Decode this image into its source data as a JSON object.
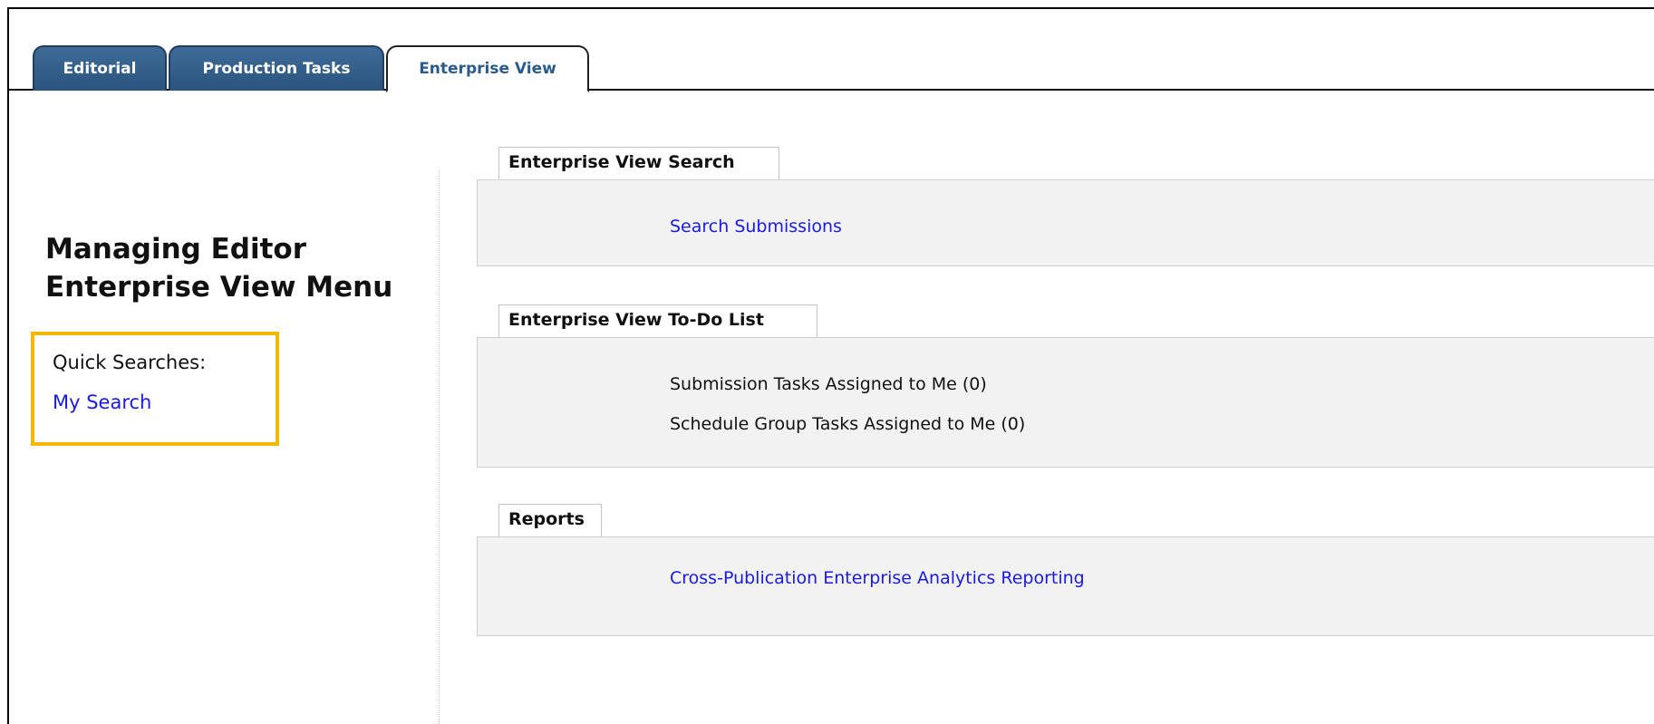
{
  "tabs": [
    {
      "label": "Editorial",
      "active": false
    },
    {
      "label": "Production Tasks",
      "active": false
    },
    {
      "label": "Enterprise View",
      "active": true
    }
  ],
  "left_panel": {
    "title_line1": "Managing Editor",
    "title_line2": "Enterprise View Menu",
    "quick_searches_label": "Quick Searches:",
    "quick_search_link": "My Search",
    "highlight_color": "#f5b800"
  },
  "sections": {
    "search": {
      "header": "Enterprise View Search",
      "link": "Search Submissions"
    },
    "todo": {
      "header": "Enterprise View To-Do List",
      "items": [
        "Submission Tasks Assigned to Me (0)",
        "Schedule Group Tasks Assigned to Me (0)"
      ]
    },
    "reports": {
      "header": "Reports",
      "link": "Cross-Publication Enterprise Analytics Reporting"
    }
  },
  "colors": {
    "tab_active_text": "#2b5a8c",
    "tab_inactive_bg": "#2b547f",
    "link": "#1a1ae6",
    "panel_bg": "#f2f2f2"
  }
}
